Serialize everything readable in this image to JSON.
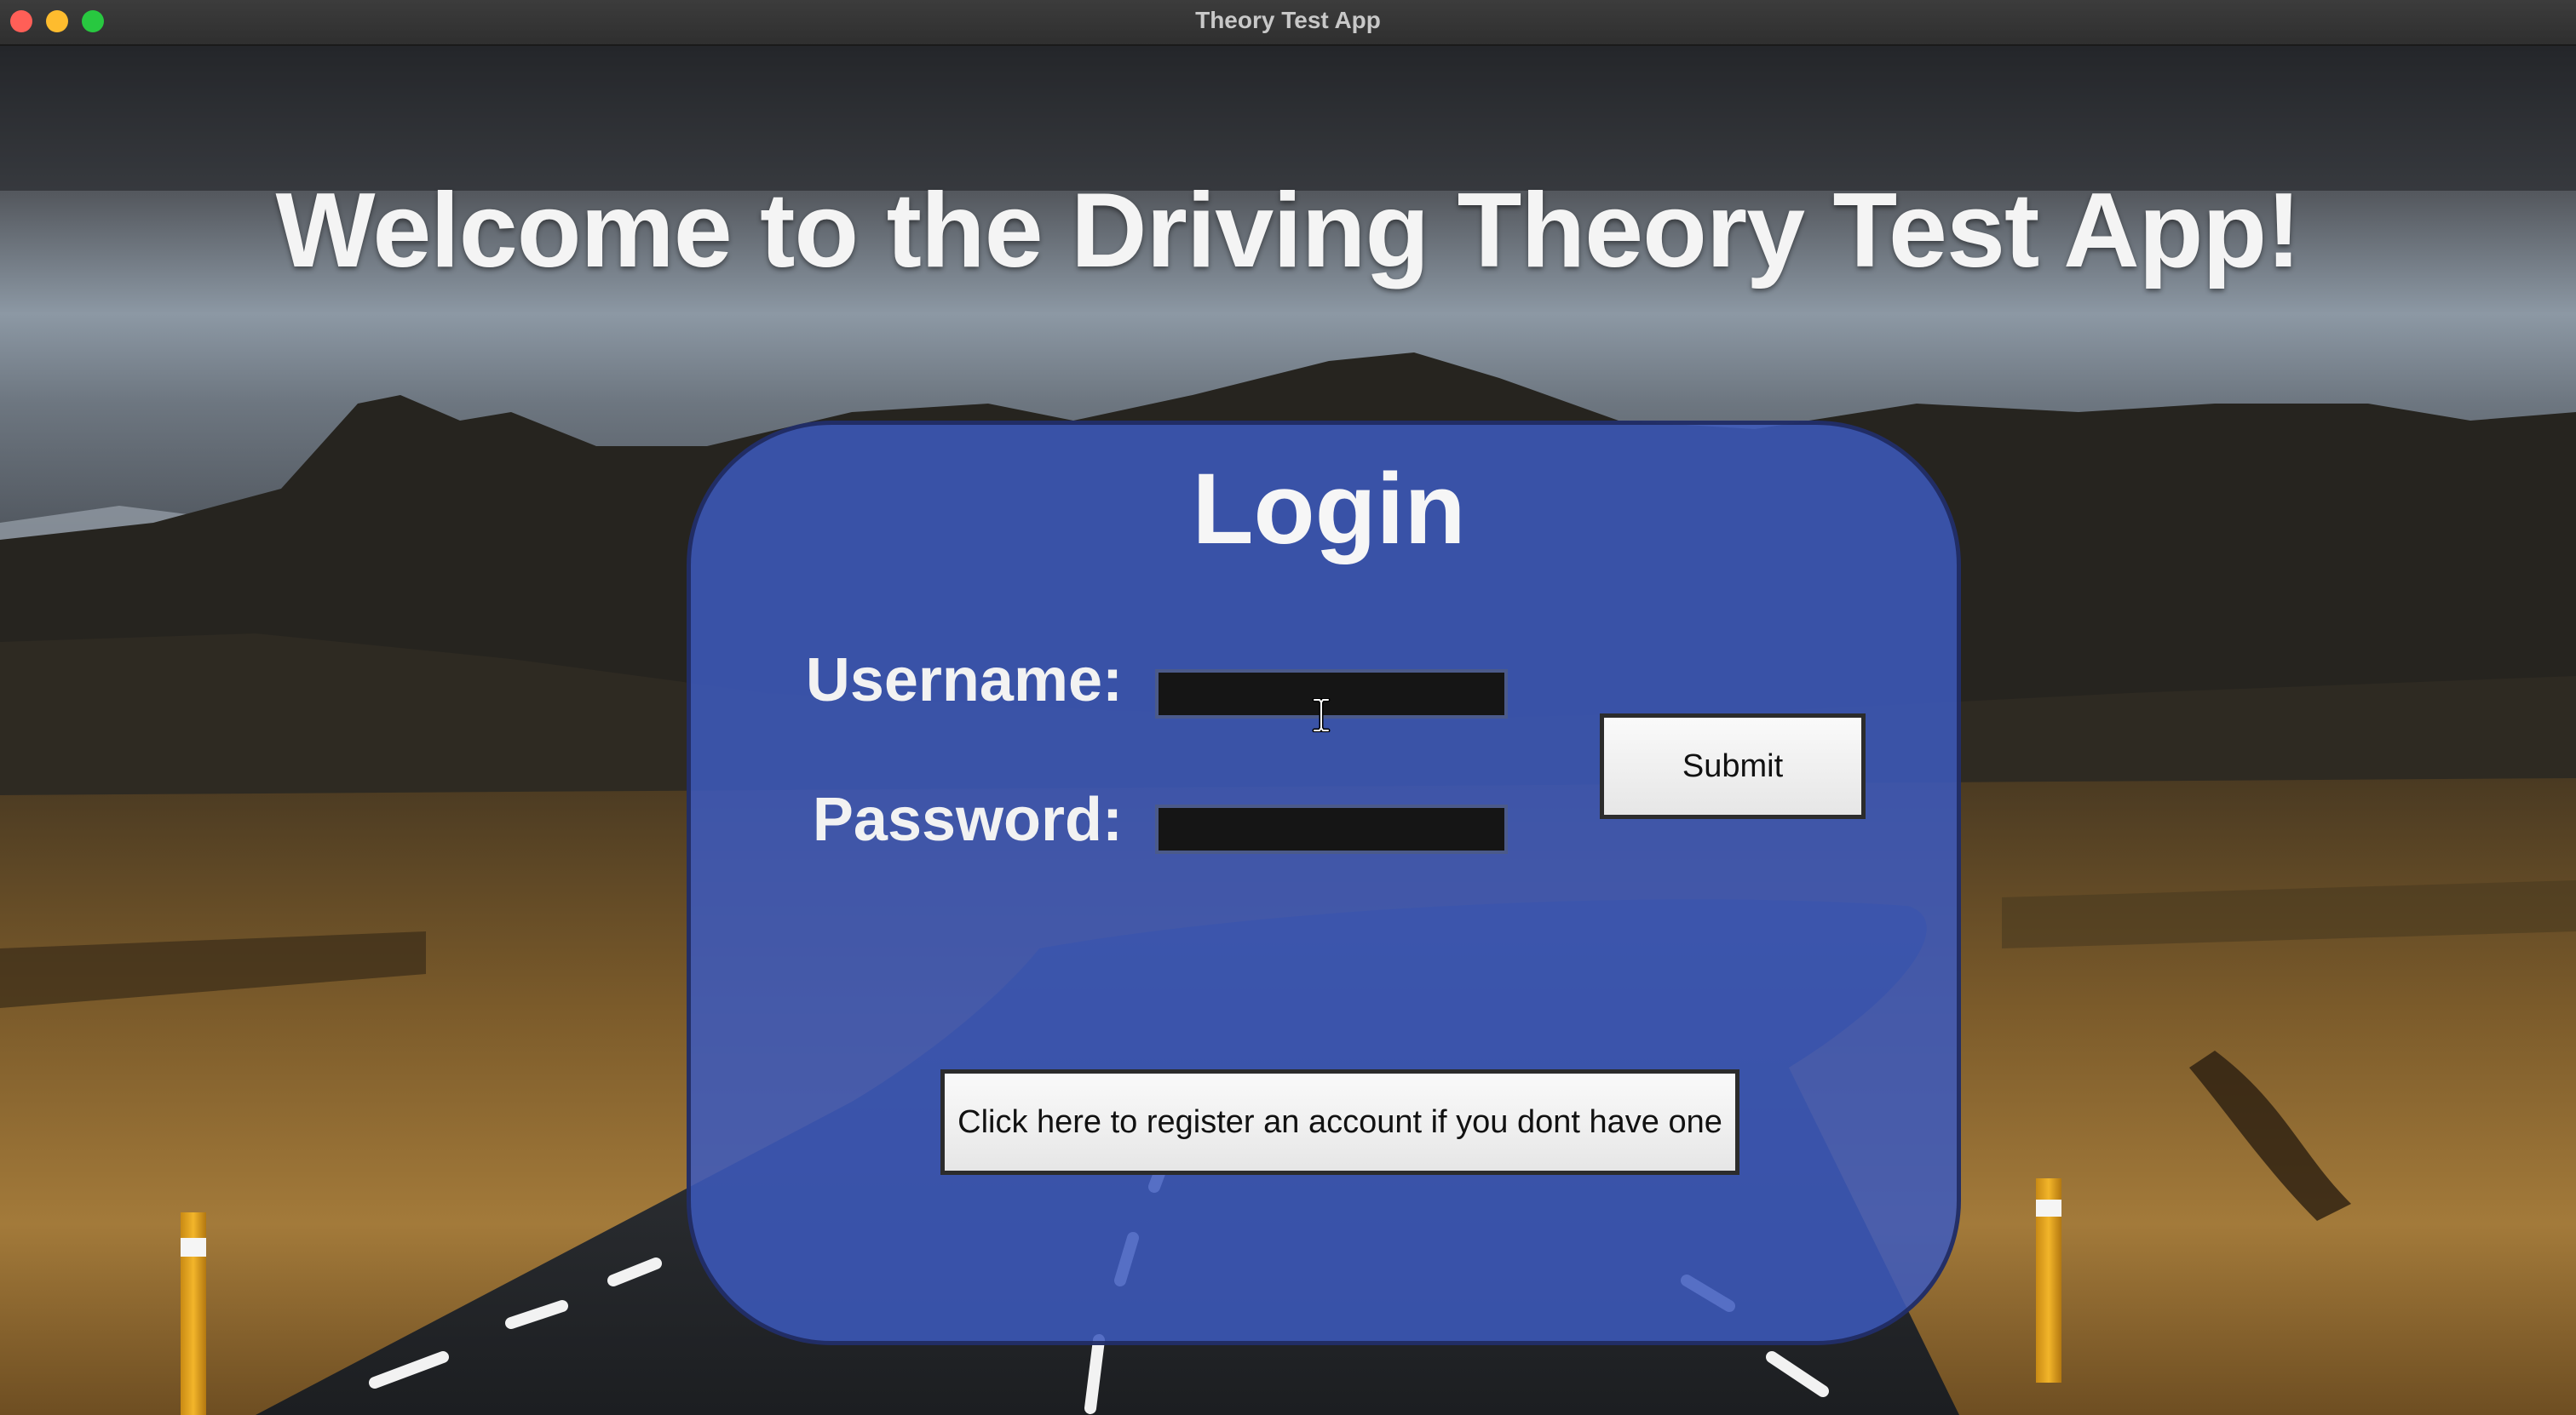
{
  "window": {
    "title": "Theory Test App"
  },
  "page": {
    "heading": "Welcome to the Driving Theory Test App!"
  },
  "login": {
    "title": "Login",
    "username_label": "Username:",
    "username_value": "",
    "password_label": "Password:",
    "password_value": "",
    "submit_label": "Submit",
    "register_label": "Click here to register an account if you dont have one"
  },
  "colors": {
    "card_fill": "#3c5abe",
    "input_fill": "#151515",
    "button_fill": "#f2f2f2",
    "close_dot": "#ff5f57",
    "minimize_dot": "#febc2e",
    "maximize_dot": "#28c840"
  },
  "icons": {
    "cursor": "i-beam-cursor-icon",
    "close": "close-icon",
    "minimize": "minimize-icon",
    "maximize": "maximize-icon"
  }
}
